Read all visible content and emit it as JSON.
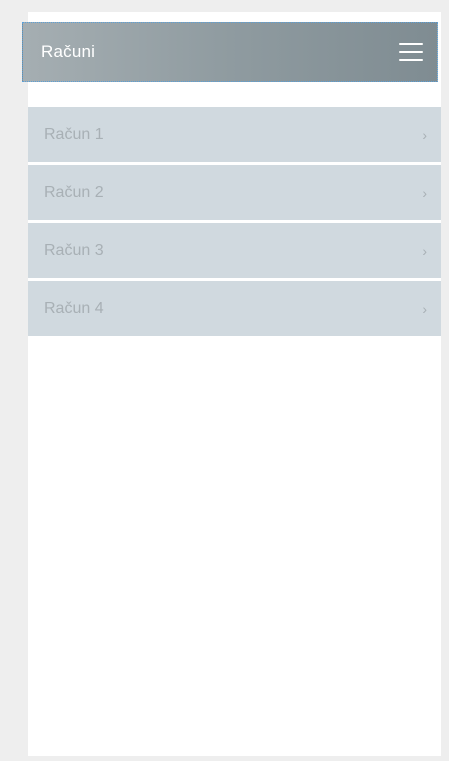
{
  "header": {
    "title": "Računi",
    "menu_icon": "hamburger-menu-icon"
  },
  "list": {
    "items": [
      {
        "label": "Račun 1",
        "chevron": "›"
      },
      {
        "label": "Račun 2",
        "chevron": "›"
      },
      {
        "label": "Račun 3",
        "chevron": "›"
      },
      {
        "label": "Račun 4",
        "chevron": "›"
      }
    ]
  },
  "colors": {
    "header_gradient_start": "#a5aeb2",
    "header_gradient_end": "#7f8c92",
    "list_item_background": "#d0d9df",
    "list_item_text": "#a8b0b5",
    "page_background": "#eeeeee"
  }
}
